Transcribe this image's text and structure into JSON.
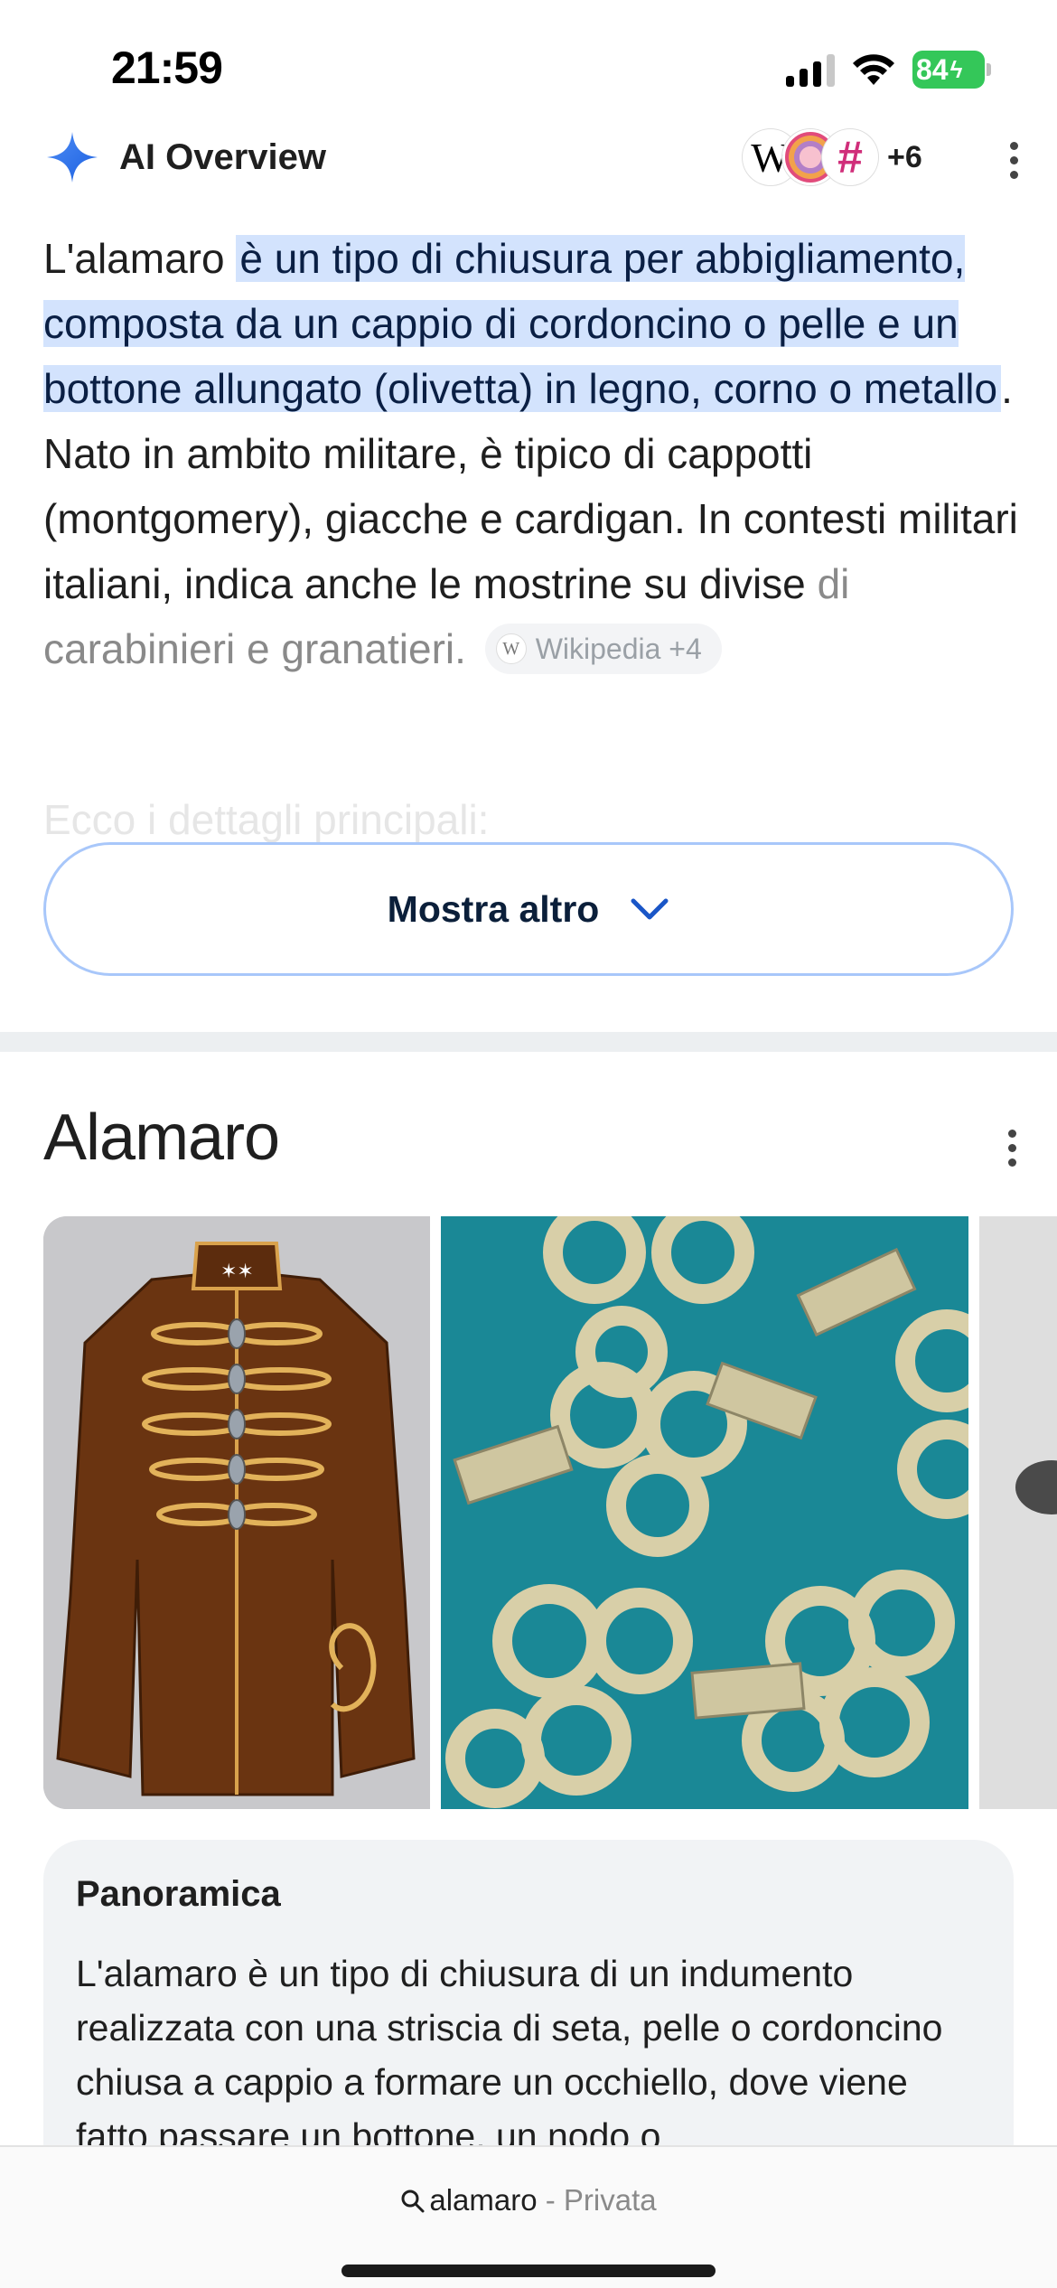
{
  "status": {
    "time": "21:59",
    "battery": "84"
  },
  "ai_overview": {
    "title": "AI Overview",
    "sources_more": "+6",
    "text_intro": "L'alamaro ",
    "text_highlight": "è un tipo di chiusura per abbigliamento, composta da un cappio di cordoncino o pelle e un bottone allungato (olivetta) in legno, corno o metallo",
    "text_rest": ". Nato in ambito militare, è tipico di cappotti (montgomery), giacche e cardigan. In contesti militari italiani, indica anche le mostrine su divise ",
    "text_faded": "di carabinieri e granatieri.",
    "citation_chip": "Wikipedia +4",
    "next_heading": "Ecco i dettagli principali:",
    "show_more": "Mostra altro"
  },
  "knowledge_panel": {
    "title": "Alamaro",
    "overview_title": "Panoramica",
    "overview_text": "L'alamaro è un tipo di chiusura di un indumento realizzata con una striscia di seta, pelle o cordoncino chiusa a cappio a formare un occhiello, dove viene fatto passare un bottone, un nodo o"
  },
  "browser": {
    "query": "alamaro",
    "separator": "-",
    "mode": "Privata"
  },
  "colors": {
    "highlight": "#d3e3fd",
    "button_border": "#a8c7fa",
    "battery": "#34c759"
  }
}
